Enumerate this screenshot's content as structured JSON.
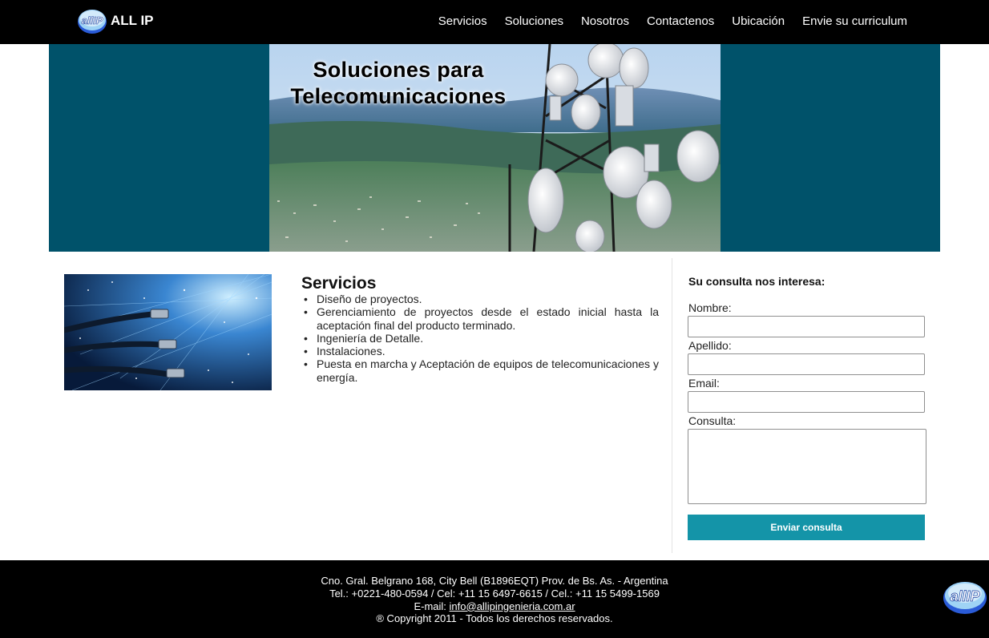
{
  "brand": {
    "logo_text": "allIP",
    "name": "ALL IP"
  },
  "nav": {
    "items": [
      "Servicios",
      "Soluciones",
      "Nosotros",
      "Contactenos",
      "Ubicación",
      "Envie su curriculum"
    ]
  },
  "hero": {
    "title_line1": "Soluciones para",
    "title_line2": "Telecomunicaciones"
  },
  "services": {
    "heading": "Servicios",
    "items": [
      "Diseño de proyectos.",
      "Gerenciamiento de proyectos desde el estado inicial hasta la aceptación final del producto terminado.",
      "Ingeniería de Detalle.",
      "Instalaciones.",
      "Puesta en marcha y Aceptación de equipos de telecomunicaciones y energía."
    ]
  },
  "form": {
    "heading": "Su consulta nos interesa:",
    "nombre_label": "Nombre:",
    "apellido_label": "Apellido:",
    "email_label": "Email:",
    "consulta_label": "Consulta:",
    "submit_label": "Enviar consulta"
  },
  "footer": {
    "address": "Cno. Gral. Belgrano 168, City Bell (B1896EQT) Prov. de Bs. As. - Argentina",
    "phones": "Tel.: +0221-480-0594 / Cel: +11 15 6497-6615 / Cel.: +11 15 5499-1569",
    "email_prefix": "E-mail: ",
    "email": "info@allipingenieria.com.ar",
    "copyright": "® Copyright 2011 - Todos los derechos reservados."
  },
  "colors": {
    "navbar_bg": "#000000",
    "hero_bg": "#00526a",
    "button_bg": "#1494a8",
    "footer_bg": "#000000"
  },
  "icons": [
    "allip-logo-icon",
    "bullet-icon",
    "allip-corner-logo-icon"
  ]
}
